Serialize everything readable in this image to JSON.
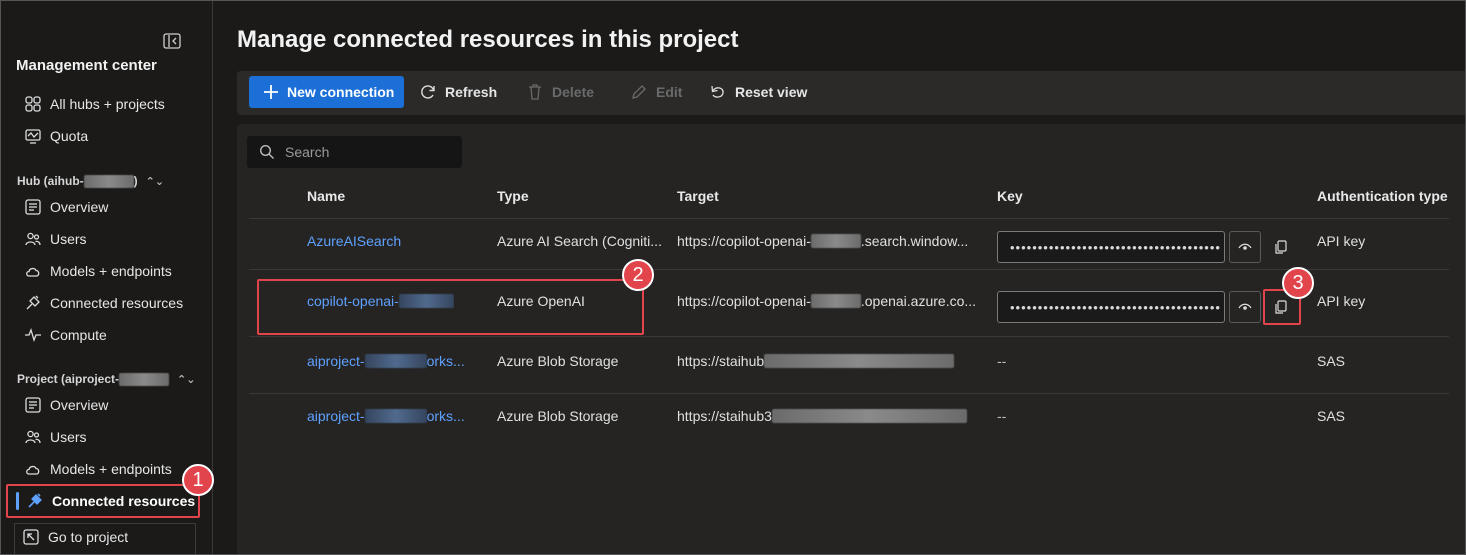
{
  "sidebar": {
    "title": "Management center",
    "top_items": [
      {
        "label": "All hubs + projects",
        "icon": "grid-icon"
      },
      {
        "label": "Quota",
        "icon": "quota-icon"
      }
    ],
    "hub_section": {
      "label": "Hub (aihub-",
      "suffix": ")"
    },
    "hub_items": [
      {
        "label": "Overview",
        "icon": "overview-icon"
      },
      {
        "label": "Users",
        "icon": "users-icon"
      },
      {
        "label": "Models + endpoints",
        "icon": "cloud-icon"
      },
      {
        "label": "Connected resources",
        "icon": "plug-icon"
      },
      {
        "label": "Compute",
        "icon": "compute-icon"
      }
    ],
    "project_section": {
      "label": "Project (aiproject-"
    },
    "project_items": [
      {
        "label": "Overview",
        "icon": "overview-icon"
      },
      {
        "label": "Users",
        "icon": "users-icon"
      },
      {
        "label": "Models + endpoints",
        "icon": "cloud-icon"
      },
      {
        "label": "Connected resources",
        "icon": "plug-icon",
        "active": true
      }
    ],
    "go_to_project": "Go to project"
  },
  "page": {
    "title": "Manage connected resources in this project"
  },
  "toolbar": {
    "new_connection": "New connection",
    "refresh": "Refresh",
    "delete": "Delete",
    "edit": "Edit",
    "reset_view": "Reset view"
  },
  "search": {
    "placeholder": "Search"
  },
  "table": {
    "columns": [
      "Name",
      "Type",
      "Target",
      "Key",
      "Authentication type"
    ],
    "rows": [
      {
        "name": "AzureAISearch",
        "type": "Azure AI Search (Cogniti...",
        "target_prefix": "https://copilot-openai-",
        "target_suffix": ".search.window...",
        "key": "••••••••••••••••••••••••••••••••••••••",
        "auth": "API key"
      },
      {
        "name": "copilot-openai-",
        "type": "Azure OpenAI",
        "target_prefix": "https://copilot-openai-",
        "target_suffix": ".openai.azure.co...",
        "key": "••••••••••••••••••••••••••••••••••••••",
        "auth": "API key"
      },
      {
        "name_prefix": "aiproject-",
        "name_suffix": "orks...",
        "type": "Azure Blob Storage",
        "target_prefix": "https://staihub",
        "key": "--",
        "auth": "SAS"
      },
      {
        "name_prefix": "aiproject-",
        "name_suffix": "orks...",
        "type": "Azure Blob Storage",
        "target_prefix": "https://staihub3",
        "key": "--",
        "auth": "SAS"
      }
    ]
  },
  "callouts": [
    "1",
    "2",
    "3"
  ],
  "colors": {
    "accent": "#1b6fd6",
    "link": "#5ea1ff",
    "highlight": "#e2444c"
  }
}
